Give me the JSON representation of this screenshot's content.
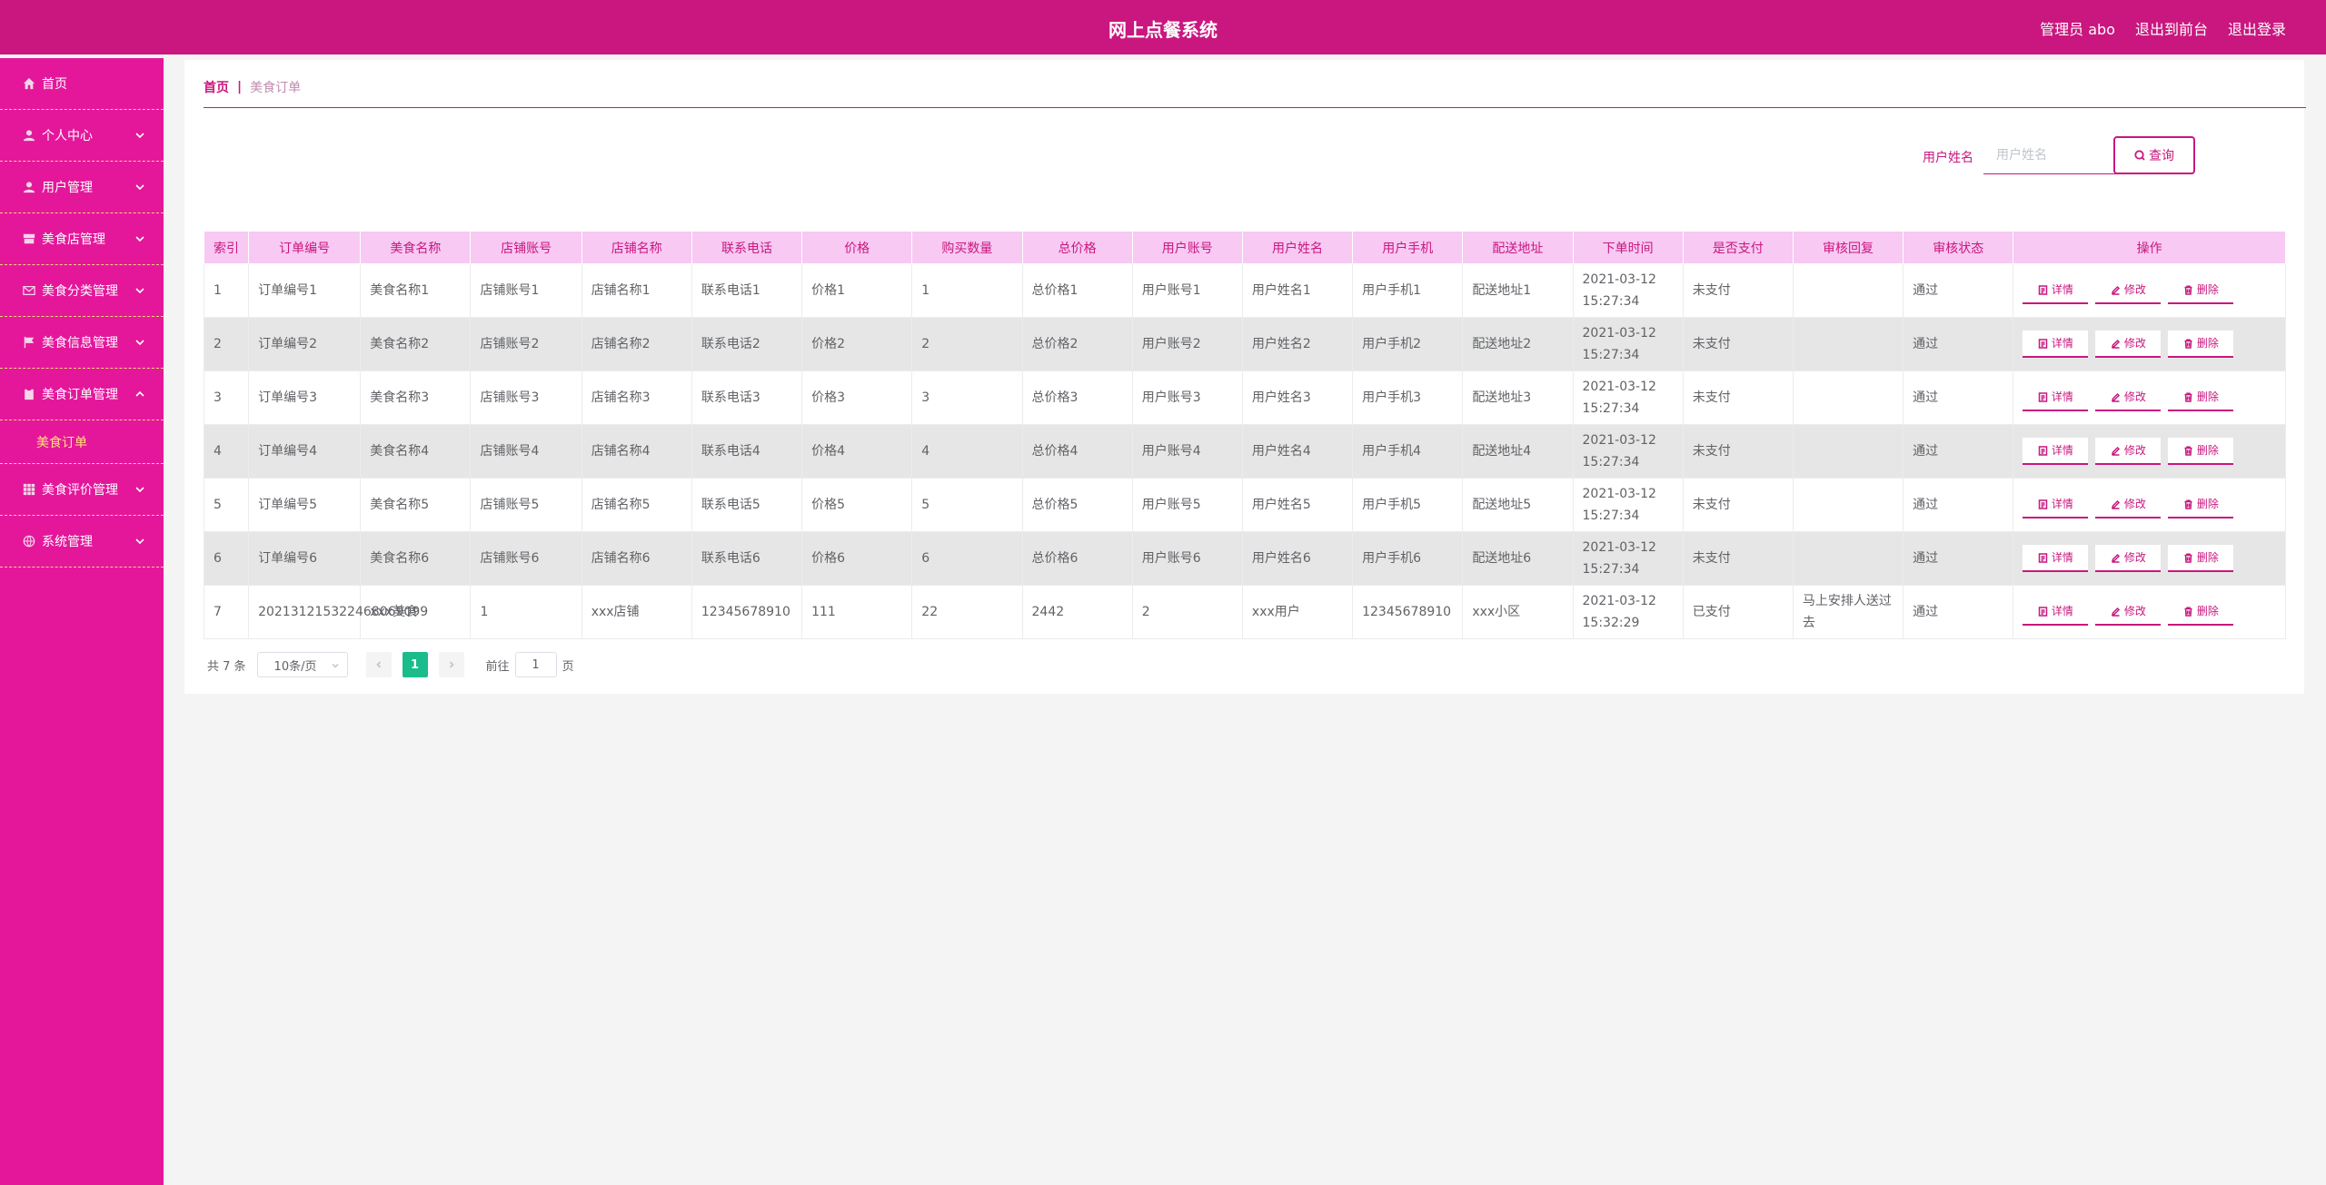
{
  "header": {
    "title": "网上点餐系统",
    "user_label": "管理员 abo",
    "back_to_front": "退出到前台",
    "logout": "退出登录"
  },
  "sidebar": {
    "items": [
      {
        "label": "首页",
        "icon": "home-icon",
        "expandable": false
      },
      {
        "label": "个人中心",
        "icon": "user-icon",
        "expandable": true
      },
      {
        "label": "用户管理",
        "icon": "user-icon",
        "expandable": true
      },
      {
        "label": "美食店管理",
        "icon": "shop-icon",
        "expandable": true
      },
      {
        "label": "美食分类管理",
        "icon": "mail-icon",
        "expandable": true
      },
      {
        "label": "美食信息管理",
        "icon": "flag-icon",
        "expandable": true
      },
      {
        "label": "美食订单管理",
        "icon": "clipboard-icon",
        "expandable": true,
        "expanded": true
      },
      {
        "label": "美食评价管理",
        "icon": "grid-icon",
        "expandable": true
      },
      {
        "label": "系统管理",
        "icon": "globe-icon",
        "expandable": true
      }
    ],
    "sub_item": "美食订单"
  },
  "breadcrumb": {
    "home": "首页",
    "separator": "|",
    "current": "美食订单"
  },
  "search": {
    "label": "用户姓名",
    "placeholder": "用户姓名",
    "value": "",
    "button": "查询"
  },
  "table": {
    "columns": [
      "索引",
      "订单编号",
      "美食名称",
      "店铺账号",
      "店铺名称",
      "联系电话",
      "价格",
      "购买数量",
      "总价格",
      "用户账号",
      "用户姓名",
      "用户手机",
      "配送地址",
      "下单时间",
      "是否支付",
      "审核回复",
      "审核状态",
      "操作"
    ],
    "rows": [
      [
        "1",
        "订单编号1",
        "美食名称1",
        "店铺账号1",
        "店铺名称1",
        "联系电话1",
        "价格1",
        "1",
        "总价格1",
        "用户账号1",
        "用户姓名1",
        "用户手机1",
        "配送地址1",
        "2021-03-12 15:27:34",
        "未支付",
        "",
        "通过"
      ],
      [
        "2",
        "订单编号2",
        "美食名称2",
        "店铺账号2",
        "店铺名称2",
        "联系电话2",
        "价格2",
        "2",
        "总价格2",
        "用户账号2",
        "用户姓名2",
        "用户手机2",
        "配送地址2",
        "2021-03-12 15:27:34",
        "未支付",
        "",
        "通过"
      ],
      [
        "3",
        "订单编号3",
        "美食名称3",
        "店铺账号3",
        "店铺名称3",
        "联系电话3",
        "价格3",
        "3",
        "总价格3",
        "用户账号3",
        "用户姓名3",
        "用户手机3",
        "配送地址3",
        "2021-03-12 15:27:34",
        "未支付",
        "",
        "通过"
      ],
      [
        "4",
        "订单编号4",
        "美食名称4",
        "店铺账号4",
        "店铺名称4",
        "联系电话4",
        "价格4",
        "4",
        "总价格4",
        "用户账号4",
        "用户姓名4",
        "用户手机4",
        "配送地址4",
        "2021-03-12 15:27:34",
        "未支付",
        "",
        "通过"
      ],
      [
        "5",
        "订单编号5",
        "美食名称5",
        "店铺账号5",
        "店铺名称5",
        "联系电话5",
        "价格5",
        "5",
        "总价格5",
        "用户账号5",
        "用户姓名5",
        "用户手机5",
        "配送地址5",
        "2021-03-12 15:27:34",
        "未支付",
        "",
        "通过"
      ],
      [
        "6",
        "订单编号6",
        "美食名称6",
        "店铺账号6",
        "店铺名称6",
        "联系电话6",
        "价格6",
        "6",
        "总价格6",
        "用户账号6",
        "用户姓名6",
        "用户手机6",
        "配送地址6",
        "2021-03-12 15:27:34",
        "未支付",
        "",
        "通过"
      ],
      [
        "7",
        "202131215322468069099",
        "xxx美食",
        "1",
        "xxx店铺",
        "12345678910",
        "111",
        "22",
        "2442",
        "2",
        "xxx用户",
        "12345678910",
        "xxx小区",
        "2021-03-12 15:32:29",
        "已支付",
        "马上安排人送过去",
        "通过"
      ]
    ],
    "actions": {
      "detail": "详情",
      "edit": "修改",
      "delete": "删除"
    }
  },
  "pagination": {
    "total": "共 7 条",
    "page_size": "10条/页",
    "current_page": "1",
    "goto_prefix": "前往",
    "goto_value": "1",
    "goto_suffix": "页"
  },
  "colors": {
    "header": "#c9177f",
    "sidebar": "#e4179b",
    "accent": "#c9177f",
    "table_header": "#f7c9f3",
    "page_active": "#1bbc8c",
    "submenu_text": "#ffe37a"
  }
}
